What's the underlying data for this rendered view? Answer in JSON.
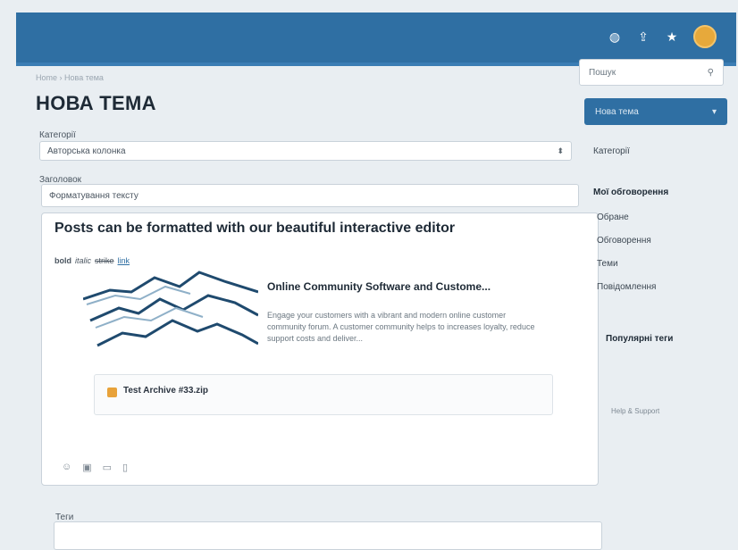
{
  "header": {
    "icons": [
      "globe-icon",
      "upload-icon",
      "star-icon"
    ]
  },
  "breadcrumb": "Home › Нова тема",
  "page_title": "НОВА ТЕМА",
  "form": {
    "category_label": "Категорії",
    "category_value": "Авторська колонка",
    "title_label": "Заголовок",
    "title_value": "Форматування тексту",
    "tags_label": "Теги"
  },
  "editor": {
    "heading": "Posts can be formatted with our beautiful interactive editor",
    "fmt": {
      "bold": "bold",
      "italic": "italic",
      "strike": "strike",
      "link": "link"
    },
    "card_title": "Online Community Software and Custome...",
    "card_desc": "Engage your customers with a vibrant and modern online customer community forum. A customer community helps to increases loyalty, reduce support costs and deliver...",
    "attachment": "Test Archive #33.zip"
  },
  "sidebar": {
    "search_placeholder": "Пошук",
    "new_topic": "Нова тема",
    "categories": "Категорії",
    "my_discussions": "Мої обговорення",
    "items": [
      {
        "label": "Обране"
      },
      {
        "label": "Обговорення"
      },
      {
        "label": "Теми"
      },
      {
        "label": "Повідомлення"
      }
    ],
    "popular_tags": "Популярні теги",
    "help": "Help & Support"
  },
  "colors": {
    "header": "#2f6fa3",
    "accent_button": "#2f6fa3",
    "attachment_icon": "#e8a23a"
  }
}
